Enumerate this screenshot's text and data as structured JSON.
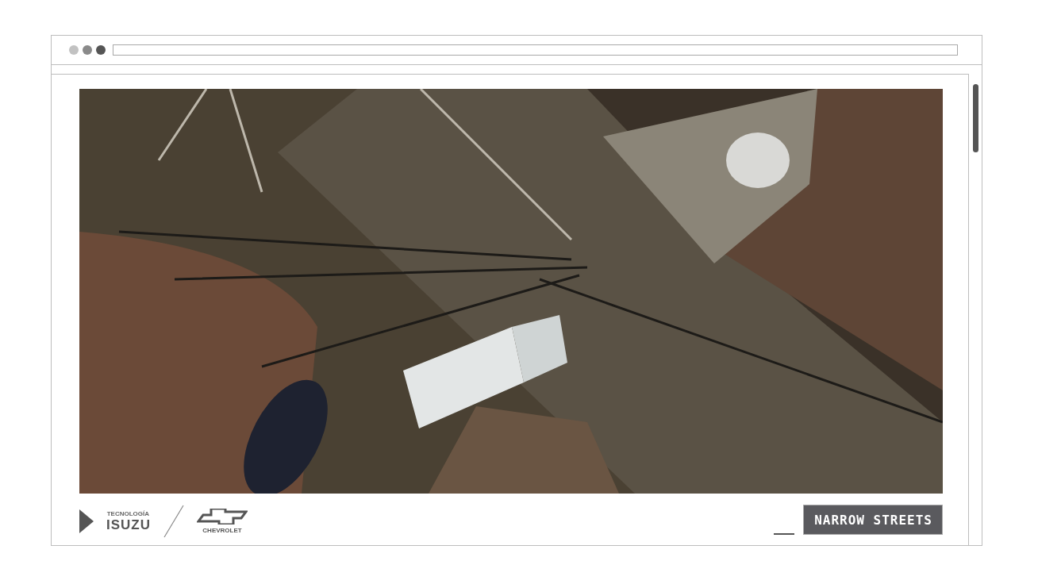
{
  "video": {
    "kind": "aerial"
  },
  "footer": {
    "brand_small": "TECNOLOGÍA",
    "brand_main": "ISUZU",
    "brand_second": "CHEVROLET",
    "caption": "NARROW STREETS"
  }
}
